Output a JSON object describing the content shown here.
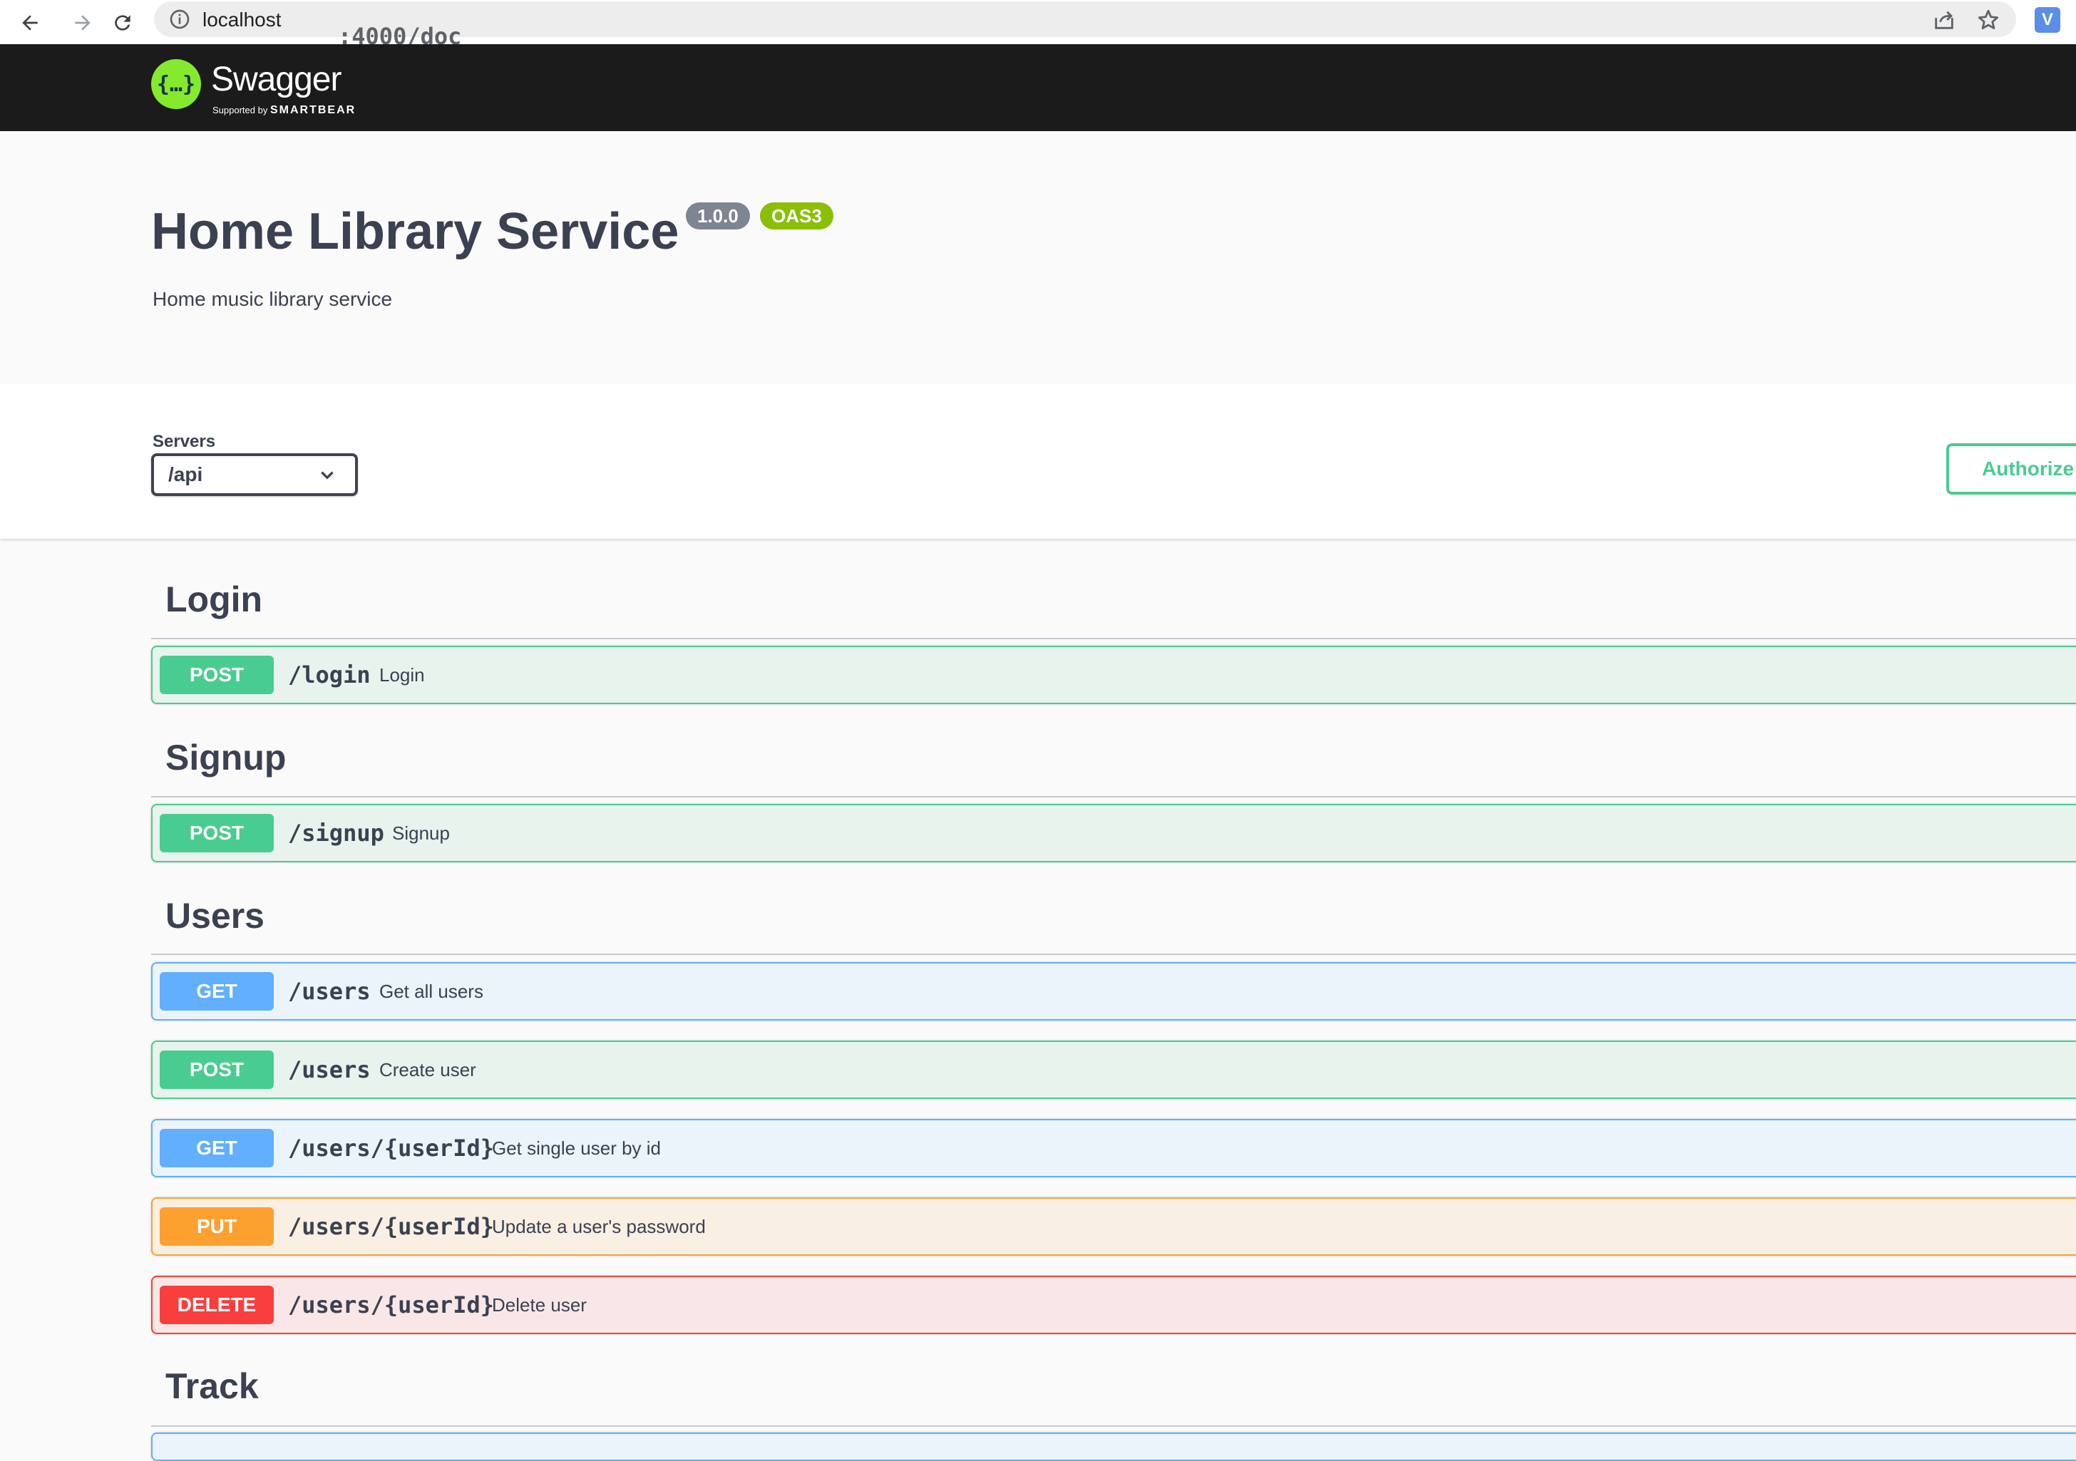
{
  "browser": {
    "url_host": "localhost",
    "url_path": ":4000/doc",
    "profile_initial": "V"
  },
  "topbar": {
    "logo_glyph": "{…}",
    "logo_title": "Swagger",
    "logo_sub_prefix": "Supported by",
    "logo_sub_brand": "SMARTBEAR"
  },
  "info": {
    "title": "Home Library Service",
    "version": "1.0.0",
    "oas": "OAS3",
    "description": "Home music library service"
  },
  "scheme": {
    "servers_label": "Servers",
    "selected_server": "/api",
    "authorize_label": "Authorize"
  },
  "tags": {
    "login": "Login",
    "signup": "Signup",
    "users": "Users",
    "track": "Track"
  },
  "operations": [
    {
      "method": "POST",
      "path": "/login",
      "summary": "Login"
    },
    {
      "method": "POST",
      "path": "/signup",
      "summary": "Signup"
    },
    {
      "method": "GET",
      "path": "/users",
      "summary": "Get all users"
    },
    {
      "method": "POST",
      "path": "/users",
      "summary": "Create user"
    },
    {
      "method": "GET",
      "path": "/users/{userId}",
      "summary": "Get single user by id"
    },
    {
      "method": "PUT",
      "path": "/users/{userId}",
      "summary": "Update a user's password"
    },
    {
      "method": "DELETE",
      "path": "/users/{userId}",
      "summary": "Delete user"
    }
  ],
  "colors": {
    "post": "#49cc90",
    "get": "#61affe",
    "put": "#fca130",
    "delete": "#f93e3e",
    "topbar": "#1b1b1b",
    "swagger_green": "#85ea2d"
  }
}
